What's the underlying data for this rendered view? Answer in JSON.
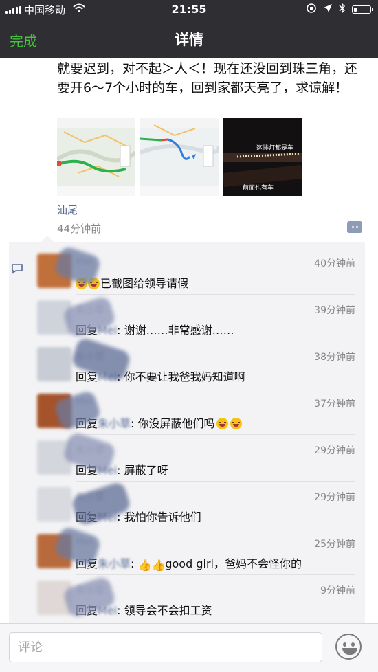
{
  "status_bar": {
    "carrier": "中国移动",
    "time": "21:55",
    "battery_level": 0.2
  },
  "nav": {
    "done_label": "完成",
    "title": "详情"
  },
  "post": {
    "text": "就要迟到，对不起＞人＜！现在还没回到珠三角，还要开6～7个小时的车，回到家都天亮了，求谅解！",
    "photo_captions": {
      "photo3_line1": "这排灯都是车",
      "photo3_line2": "前面也有车"
    },
    "location": "汕尾",
    "time_ago": "44分钟前"
  },
  "comments": [
    {
      "name": "Mei",
      "time": "40分钟前",
      "reply_word": "",
      "reply_to": "",
      "separator": "",
      "text": "已截图给领导请假",
      "emojis": 2,
      "avatar_color": "#c0703a"
    },
    {
      "name": "朱小草",
      "time": "39分钟前",
      "reply_word": "回复",
      "reply_to": "Mei",
      "separator": ": ",
      "text": "谢谢……非常感谢……",
      "emojis": 0,
      "avatar_color": "#cfd3dc"
    },
    {
      "name": "朱小草",
      "time": "38分钟前",
      "reply_word": "回复",
      "reply_to": "Mei",
      "separator": ": ",
      "text": "你不要让我爸我妈知道啊",
      "emojis": 0,
      "avatar_color": "#c8ccd4"
    },
    {
      "name": "Mei",
      "time": "37分钟前",
      "reply_word": "回复",
      "reply_to": "朱小草",
      "separator": ": ",
      "text": "你没屏蔽他们吗",
      "emojis_after": 2,
      "avatar_color": "#a5532a"
    },
    {
      "name": "朱小草",
      "time": "29分钟前",
      "reply_word": "回复",
      "reply_to": "Mei",
      "separator": ": ",
      "text": "屏蔽了呀",
      "emojis": 0,
      "avatar_color": "#d3d6dc"
    },
    {
      "name": "朱小草",
      "time": "29分钟前",
      "reply_word": "回复",
      "reply_to": "Mei",
      "separator": ": ",
      "text": "我怕你告诉他们",
      "emojis": 0,
      "avatar_color": "#d8dadf"
    },
    {
      "name": "Mei",
      "time": "25分钟前",
      "reply_word": "回复",
      "reply_to": "朱小草",
      "separator": ": ",
      "text": "good girl，爸妈不会怪你的",
      "thumbs": 2,
      "avatar_color": "#b86a3c"
    },
    {
      "name": "朱小草",
      "time": "9分钟前",
      "reply_word": "回复",
      "reply_to": "Mei",
      "separator": ": ",
      "text": "领导会不会扣工资",
      "emojis": 0,
      "avatar_color": "#e0d8d6"
    }
  ],
  "input": {
    "placeholder": "评论"
  },
  "colors": {
    "accent_green": "#45c43d",
    "link_blue": "#576b95",
    "topbar": "#2e2e33"
  }
}
